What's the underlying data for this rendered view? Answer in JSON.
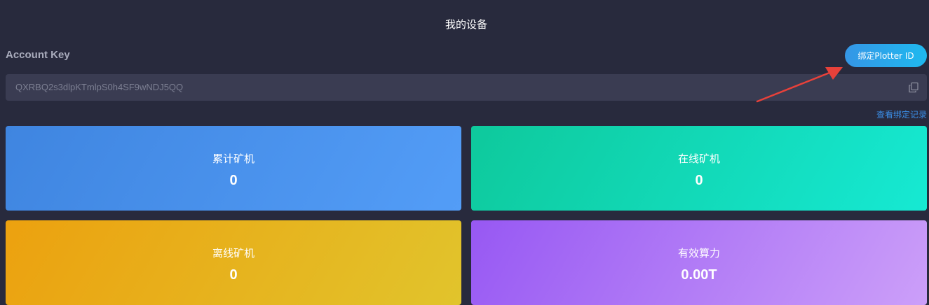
{
  "header": {
    "title": "我的设备"
  },
  "account": {
    "label": "Account Key",
    "key_value": "QXRBQ2s3dlpKTmlpS0h4SF9wNDJ5QQ",
    "bind_button_label": "绑定Plotter ID",
    "history_link_label": "查看绑定记录"
  },
  "stats": [
    {
      "label": "累计矿机",
      "value": "0"
    },
    {
      "label": "在线矿机",
      "value": "0"
    },
    {
      "label": "离线矿机",
      "value": "0"
    },
    {
      "label": "有效算力",
      "value": "0.00T"
    }
  ],
  "colors": {
    "background": "#282a3d",
    "button": "#1fb9ef",
    "link": "#3b8fe8",
    "arrow": "#e8413a",
    "card_total": "#4a94ee",
    "card_online": "#12d9b8",
    "card_offline": "#e6b21f",
    "card_power": "#b07bf6"
  },
  "icons": {
    "copy": "copy-icon"
  }
}
